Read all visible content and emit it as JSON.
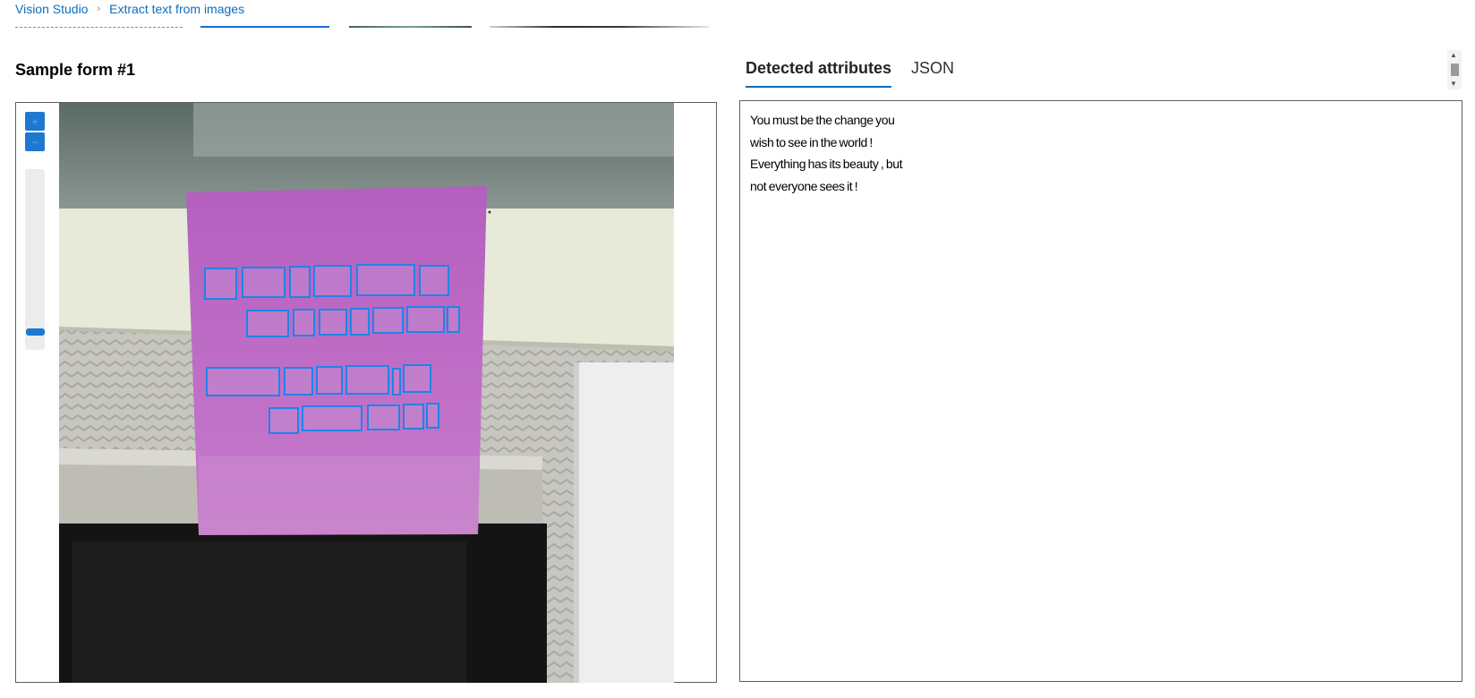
{
  "breadcrumb": {
    "home": "Vision Studio",
    "separator": "›",
    "current": "Extract text from images"
  },
  "sample": {
    "title": "Sample form #1"
  },
  "viewer": {
    "zoom_in_icon": "plus-icon",
    "zoom_out_icon": "minus-icon",
    "zoom_level": 0.05
  },
  "tabs": [
    {
      "label": "Detected attributes",
      "active": true
    },
    {
      "label": "JSON",
      "active": false
    }
  ],
  "detected_lines": [
    "You must be the change you",
    "wish to see in the world !",
    "Everything has its beauty , but",
    "not everyone sees it !"
  ],
  "colors": {
    "accent": "#0f6cbd",
    "bounding_box": "#1f84e8",
    "note": "#b761c0"
  }
}
